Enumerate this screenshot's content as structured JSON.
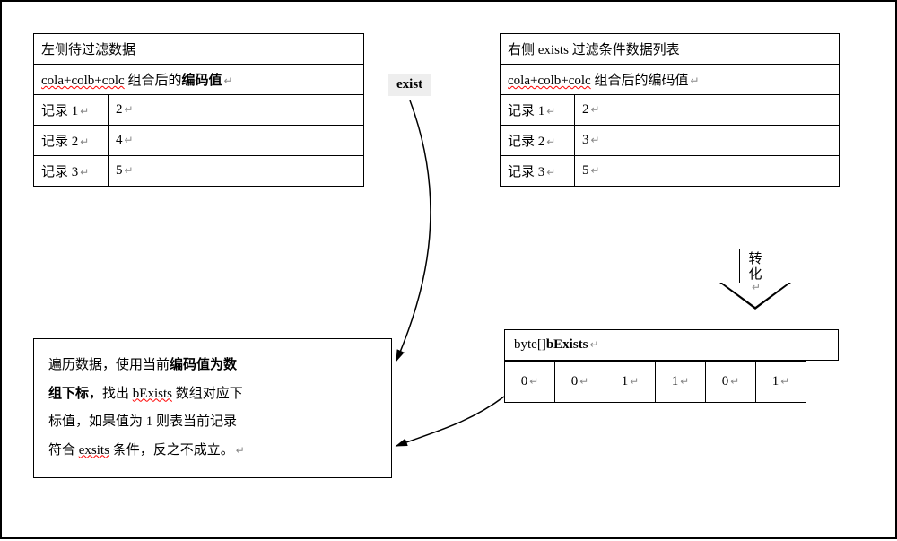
{
  "left_table": {
    "title": "左侧待过滤数据",
    "header_prefix": "cola+colb+colc",
    "header_mid": " 组合后的",
    "header_bold": "编码值",
    "rows": [
      {
        "k": "记录 1",
        "v": "2"
      },
      {
        "k": "记录 2",
        "v": "4"
      },
      {
        "k": "记录 3",
        "v": "5"
      }
    ]
  },
  "right_table": {
    "title": "右侧 exists 过滤条件数据列表",
    "header_prefix": "cola+colb+colc",
    "header_mid": " 组合后的编码值",
    "rows": [
      {
        "k": "记录 1",
        "v": "2"
      },
      {
        "k": "记录 2",
        "v": "3"
      },
      {
        "k": "记录 3",
        "v": "5"
      }
    ]
  },
  "exist_label": "exist",
  "convert_label": "转化",
  "byte_header_a": "byte[] ",
  "byte_header_b": "bExists",
  "byte_cells": [
    "0",
    "0",
    "1",
    "1",
    "0",
    "1"
  ],
  "desc": {
    "l1a": "遍历数据，使用当前",
    "l1b": "编码值为数",
    "l2a": "组下标",
    "l2b": "，找出 ",
    "l2c": "bExists",
    "l2d": " 数组对应下",
    "l3": "标值，如果值为 1 则表当前记录",
    "l4a": "符合 ",
    "l4b": "exsits",
    "l4c": " 条件，反之不成立。"
  }
}
